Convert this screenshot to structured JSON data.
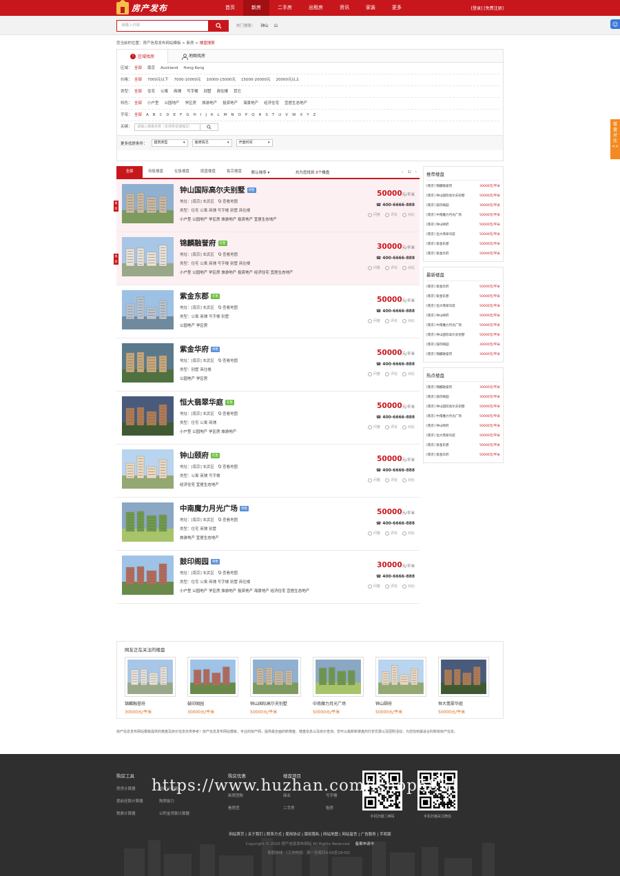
{
  "header": {
    "logo_text": "房产发布",
    "nav": [
      "首页",
      "新房",
      "二手房",
      "出租房",
      "资讯",
      "家装",
      "更多"
    ],
    "nav_active": 1,
    "links": "[登录] [免费注册]"
  },
  "search": {
    "placeholder": "请输入内容",
    "hot_label": "热门搜索：",
    "hot": [
      "钟山",
      "山"
    ]
  },
  "breadcrumb": {
    "prefix": "您当前的位置：",
    "site": "房产信息发布网站模板",
    "sep1": " > ",
    "section": "新房",
    "sep2": " > ",
    "current": "楼盘搜索"
  },
  "filter": {
    "tabs": [
      "区域找房",
      "地图找房"
    ],
    "rows": [
      {
        "label": "区域：",
        "options": [
          "全部",
          "南京",
          "Auckland",
          "Hong Kong"
        ]
      },
      {
        "label": "价格：",
        "options": [
          "全部",
          "7000元以下",
          "7000-10000元",
          "10000-15000元",
          "15000-20000元",
          "20000元以上"
        ]
      },
      {
        "label": "类型：",
        "options": [
          "全部",
          "住宅",
          "公寓",
          "商铺",
          "写字楼",
          "别墅",
          "商住楼",
          "其它"
        ]
      },
      {
        "label": "特色：",
        "options": [
          "全部",
          "小户型",
          "公园地产",
          "学区房",
          "旅游地产",
          "投资地产",
          "海景地产",
          "经济住宅",
          "宜居生态地产"
        ]
      },
      {
        "label": "字母：",
        "options": [
          "全部",
          "A",
          "B",
          "C",
          "D",
          "E",
          "F",
          "G",
          "H",
          "I",
          "J",
          "K",
          "L",
          "M",
          "N",
          "O",
          "P",
          "Q",
          "R",
          "S",
          "T",
          "U",
          "V",
          "W",
          "X",
          "Y",
          "Z"
        ]
      }
    ],
    "keyword_label": "关键：",
    "keyword_placeholder": "请输入楼盘名称（支持拼音或缩写）",
    "more_label": "更多找房条件：",
    "selects": [
      "建筑类型",
      "装修情况",
      "开盘时间"
    ]
  },
  "list": {
    "tabs": [
      "全部",
      "待售楼盘",
      "在售楼盘",
      "尾盘楼盘",
      "售完楼盘"
    ],
    "sort": "默认排序",
    "total_prefix": "共为您找到",
    "total_count": "8",
    "total_suffix": "个楼盘",
    "page": "1/",
    "highlight_tag": "推荐",
    "address_label": "地址：",
    "type_label": "类型：",
    "map_link": "查看地图",
    "unit": "元/平米",
    "actions": [
      "问答",
      "评论",
      "对比"
    ],
    "items": [
      {
        "name": "钟山国际高尔夫别墅",
        "badge": "待售",
        "badge_color": "#5b8fd9",
        "address": "[南京] 玄武区",
        "types": "住宅 公寓 商铺 写字楼 别墅 商住楼",
        "features": "小户型 公园地产 学区房 旅游地产 投资地产 宜居生态地产",
        "price": "50000",
        "phone": "400-6666-888",
        "hl": true
      },
      {
        "name": "锦麟融誉府",
        "badge": "在售",
        "badge_color": "#6bbf3f",
        "address": "[南京] 玄武区",
        "types": "住宅 公寓 商铺 写字楼 别墅 商住楼",
        "features": "小户型 公园地产 学区房 旅游地产 投资地产 经济住宅 宜居生态地产",
        "price": "30000",
        "phone": "400-6666-888",
        "hl": true
      },
      {
        "name": "紫金东郡",
        "badge": "在售",
        "badge_color": "#6bbf3f",
        "address": "[南京] 玄武区",
        "types": "公寓 商铺 写字楼 别墅",
        "features": "公园地产 学区房",
        "price": "50000",
        "phone": "400-6666-888",
        "hl": false
      },
      {
        "name": "紫金华府",
        "badge": "待售",
        "badge_color": "#5b8fd9",
        "address": "[南京] 玄武区",
        "types": "别墅 商住楼",
        "features": "公园地产 学区房",
        "price": "50000",
        "phone": "400-6666-888",
        "hl": false
      },
      {
        "name": "恒大翡翠华庭",
        "badge": "在售",
        "badge_color": "#6bbf3f",
        "address": "[南京] 玄武区",
        "types": "住宅 公寓 商铺",
        "features": "小户型 公园地产 学区房 旅游地产",
        "price": "50000",
        "phone": "400-6666-888",
        "hl": false
      },
      {
        "name": "钟山颐府",
        "badge": "在售",
        "badge_color": "#6bbf3f",
        "address": "[南京] 玄武区",
        "types": "公寓 商铺 写字楼",
        "features": "经济住宅 宜居生态地产",
        "price": "50000",
        "phone": "400-6666-888",
        "hl": false
      },
      {
        "name": "中南魔力月光广场",
        "badge": "待售",
        "badge_color": "#5b8fd9",
        "address": "[南京] 玄武区",
        "types": "住宅 商铺 别墅",
        "features": "旅游地产 宜居生态地产",
        "price": "50000",
        "phone": "400-6666-888",
        "hl": false
      },
      {
        "name": "鼓印阁园",
        "badge": "待售",
        "badge_color": "#5b8fd9",
        "address": "[南京] 玄武区",
        "types": "住宅 公寓 商铺 写字楼 别墅 商住楼",
        "features": "小户型 公园地产 学区房 旅游地产 投资地产 海景地产 经济住宅 宜居生态地产",
        "price": "30000",
        "phone": "400-6666-888",
        "hl": false
      }
    ]
  },
  "sidebar": {
    "boxes": [
      {
        "title": "推荐楼盘",
        "rows": [
          [
            "[南京] 锦麟融誉府",
            "30000元/平米"
          ],
          [
            "[南京] 钟山国际高尔夫别墅",
            "50000元/平米"
          ],
          [
            "[南京] 鼓印阁园",
            "30000元/平米"
          ],
          [
            "[南京] 中南魔力月光广场",
            "50000元/平米"
          ],
          [
            "[南京] 钟山颐府",
            "50000元/平米"
          ],
          [
            "[南京] 恒大翡翠华庭",
            "50000元/平米"
          ],
          [
            "[南京] 紫金东郡",
            "50000元/平米"
          ],
          [
            "[南京] 紫金华府",
            "50000元/平米"
          ]
        ]
      },
      {
        "title": "最新楼盘",
        "rows": [
          [
            "[南京] 紫金华府",
            "50000元/平米"
          ],
          [
            "[南京] 紫金东郡",
            "50000元/平米"
          ],
          [
            "[南京] 恒大翡翠华庭",
            "50000元/平米"
          ],
          [
            "[南京] 钟山颐府",
            "50000元/平米"
          ],
          [
            "[南京] 中南魔力月光广场",
            "50000元/平米"
          ],
          [
            "[南京] 钟山国际高尔夫别墅",
            "50000元/平米"
          ],
          [
            "[南京] 鼓印阁园",
            "30000元/平米"
          ],
          [
            "[南京] 锦麟融誉府",
            "30000元/平米"
          ]
        ]
      },
      {
        "title": "热点楼盘",
        "rows": [
          [
            "[南京] 锦麟融誉府",
            "30000元/平米"
          ],
          [
            "[南京] 鼓印阁园",
            "30000元/平米"
          ],
          [
            "[南京] 钟山国际高尔夫别墅",
            "50000元/平米"
          ],
          [
            "[南京] 中南魔力月光广场",
            "50000元/平米"
          ],
          [
            "[南京] 钟山颐府",
            "50000元/平米"
          ],
          [
            "[南京] 恒大翡翠华庭",
            "50000元/平米"
          ],
          [
            "[南京] 紫金东郡",
            "50000元/平米"
          ],
          [
            "[南京] 紫金华府",
            "50000元/平米"
          ]
        ]
      }
    ]
  },
  "attention": {
    "title": "网友正在关注的楼盘",
    "items": [
      {
        "name": "锦麟融誉府",
        "price": "30000元/平米"
      },
      {
        "name": "鼓印阁园",
        "price": "30000元/平米"
      },
      {
        "name": "钟山国际高尔夫别墅",
        "price": "50000元/平米"
      },
      {
        "name": "中南魔力月光广场",
        "price": "50000元/平米"
      },
      {
        "name": "钟山颐府",
        "price": "50000元/平米"
      },
      {
        "name": "恒大翡翠华庭",
        "price": "50000元/平米"
      }
    ]
  },
  "note": "房产信息发布网站模板提供的楼盘及房价信息仅供参考！房产信息发布网站模板，专业的房产网，提供最全面的新楼盘、楼盘信息以及房价查询，您可以最新新楼盘的打折优惠以及团购活动，为您找到最适合的新房房产信息。",
  "footer": {
    "cols": [
      {
        "title": "购房工具",
        "items": [
          "房贷计算器",
          "税费计算器",
          "提前还款计算器",
          "购房能力",
          "税费计算器",
          "公积金贷款计算器"
        ]
      },
      {
        "title": "购房优惠",
        "items": [
          "",
          "",
          "新房团购",
          "",
          "看房团",
          ""
        ]
      },
      {
        "title": "楼盘项目",
        "items": [
          "",
          "",
          "商业",
          "写字楼",
          "二手房",
          "租房"
        ]
      }
    ],
    "qr_captions": [
      "手机扫描二维码",
      "手机扫描关注微信"
    ],
    "links": "网站首页 | 关于我们 | 联系方式 | 使用协议 | 版权隐私 | 网站地图 | 网站留言 | 广告服务 | 手机版",
    "copyright": "Copyright © 2020 房产信息发布网站 All Rights Reserved",
    "icp": "备案申请中",
    "time": "客服热线 （工作时间：周一至周日9:00至18:00）",
    "watermark": "https://www.huzhan.com/ishop5831"
  },
  "float": {
    "compare": "楼盘对比",
    "arrow": "<<"
  }
}
